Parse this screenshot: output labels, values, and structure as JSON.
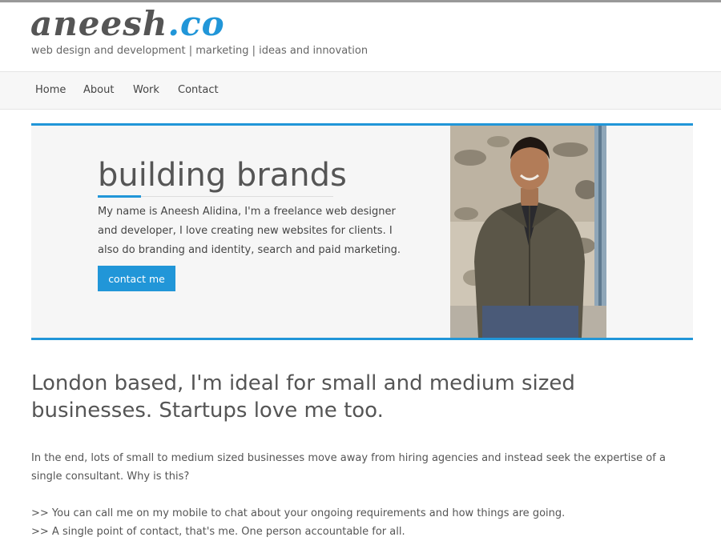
{
  "header": {
    "logo_main": "aneesh",
    "logo_accent": ".co",
    "tagline": "web design and development | marketing | ideas and innovation"
  },
  "nav": {
    "items": [
      {
        "label": "Home"
      },
      {
        "label": "About"
      },
      {
        "label": "Work"
      },
      {
        "label": "Contact"
      }
    ]
  },
  "hero": {
    "title": "building brands",
    "text": "My name is Aneesh Alidina, I'm a freelance web designer and developer, I love creating new websites for clients. I also do branding and identity, search and paid marketing.",
    "button_label": "contact me"
  },
  "main": {
    "headline": "London based, I'm ideal for small and medium sized businesses. Startups love me too.",
    "paragraph": "In the end, lots of small to medium sized businesses move away from hiring agencies and instead seek the expertise of a single consultant. Why is this?",
    "bullets": [
      ">> You can call me on my mobile to chat about your ongoing requirements and how things are going.",
      ">> A single point of contact, that's me. One person accountable for all."
    ]
  },
  "colors": {
    "accent": "#2196d8",
    "text": "#555555",
    "nav_bg": "#f7f7f7",
    "hero_bg": "#f6f6f6"
  }
}
